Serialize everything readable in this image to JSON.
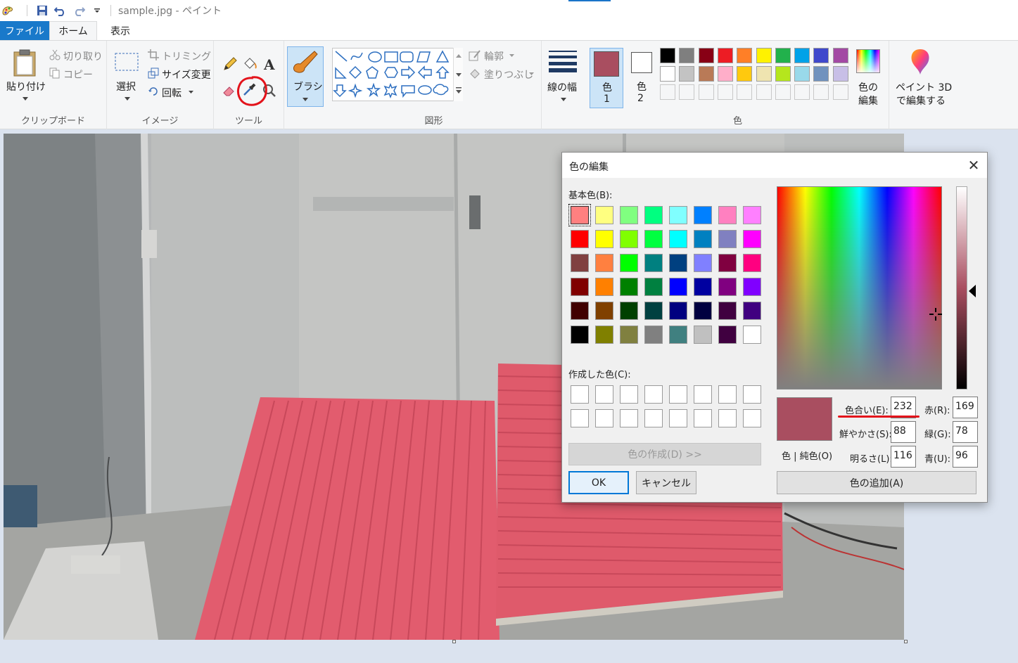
{
  "window": {
    "title": "sample.jpg - ペイント",
    "accent_color": "#1979ca"
  },
  "tabs": [
    {
      "label": "ファイル"
    },
    {
      "label": "ホーム"
    },
    {
      "label": "表示"
    }
  ],
  "ribbon": {
    "clipboard": {
      "paste": "貼り付け",
      "cut": "切り取り",
      "copy": "コピー",
      "group_label": "クリップボード"
    },
    "image": {
      "select": "選択",
      "crop": "トリミング",
      "resize": "サイズ変更",
      "rotate": "回転",
      "group_label": "イメージ"
    },
    "tools": {
      "group_label": "ツール"
    },
    "brush": {
      "label": "ブラシ"
    },
    "shapes": {
      "outline": "輪郭",
      "fill": "塗りつぶし",
      "group_label": "図形"
    },
    "line_width": {
      "label": "線の幅"
    },
    "color1": {
      "label": "色",
      "number": "1",
      "color": "#a94e60"
    },
    "color2": {
      "label": "色",
      "number": "2",
      "color": "#ffffff"
    },
    "edit_colors": {
      "line1": "色の",
      "line2": "編集"
    },
    "paint3d": {
      "line1": "ペイント 3D",
      "line2": "で編集する"
    },
    "colors_group_label": "色",
    "palette_row1": [
      "#000000",
      "#7f7f7f",
      "#880015",
      "#ed1c24",
      "#ff7f27",
      "#fff200",
      "#22b14c",
      "#00a2e8",
      "#3f48cc",
      "#a349a4"
    ],
    "palette_row2": [
      "#ffffff",
      "#c3c3c3",
      "#b97a57",
      "#ffaec9",
      "#ffc90e",
      "#efe4b0",
      "#b5e61d",
      "#99d9ea",
      "#7092be",
      "#c8bfe7"
    ],
    "palette_row3": [
      "",
      "",
      "",
      "",
      "",
      "",
      "",
      "",
      "",
      ""
    ]
  },
  "dialog": {
    "title": "色の編集",
    "basic_colors_label": "基本色(B):",
    "basic_colors": [
      [
        "#ff8080",
        "#ffff80",
        "#80ff80",
        "#00ff80",
        "#80ffff",
        "#0080ff",
        "#ff80c0",
        "#ff80ff"
      ],
      [
        "#ff0000",
        "#ffff00",
        "#80ff00",
        "#00ff40",
        "#00ffff",
        "#0080c0",
        "#8080c0",
        "#ff00ff"
      ],
      [
        "#804040",
        "#ff8040",
        "#00ff00",
        "#008080",
        "#004080",
        "#8080ff",
        "#800040",
        "#ff0080"
      ],
      [
        "#800000",
        "#ff8000",
        "#008000",
        "#008040",
        "#0000ff",
        "#0000a0",
        "#800080",
        "#8000ff"
      ],
      [
        "#400000",
        "#804000",
        "#004000",
        "#004040",
        "#000080",
        "#000040",
        "#400040",
        "#400080"
      ],
      [
        "#000000",
        "#808000",
        "#808040",
        "#808080",
        "#408080",
        "#c0c0c0",
        "#400040",
        "#ffffff"
      ]
    ],
    "custom_colors_label": "作成した色(C):",
    "define_button": "色の作成(D) >>",
    "ok_button": "OK",
    "cancel_button": "キャンセル",
    "preview_color": "#a94e60",
    "preview_label": "色 | 純色(O)",
    "hue_label": "色合い(E):",
    "hue": "232",
    "sat_label": "鮮やかさ(S):",
    "sat": "88",
    "lum_label": "明るさ(L):",
    "lum": "116",
    "red_label": "赤(R):",
    "red": "169",
    "green_label": "緑(G):",
    "green": "78",
    "blue_label": "青(U):",
    "blue": "96",
    "add_button": "色の追加(A)"
  },
  "annotations": {
    "circle_color": "#e3131b",
    "underline_color": "#e3131b"
  }
}
